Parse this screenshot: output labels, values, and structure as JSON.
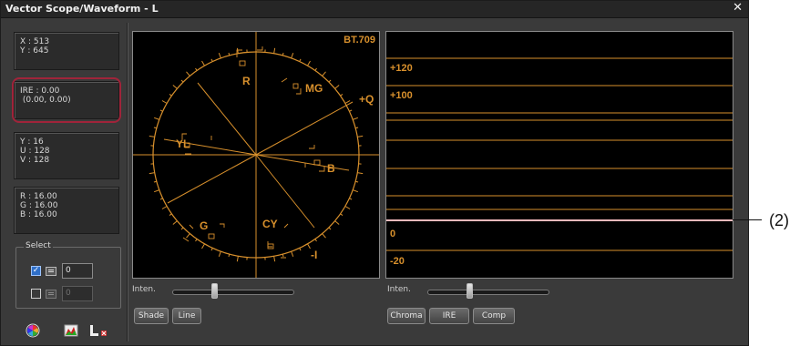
{
  "window": {
    "title": "Vector Scope/Waveform - L",
    "close_glyph": "✕"
  },
  "left_panel": {
    "position": "X : 513\nY : 645",
    "ire": "IRE : 0.00\n (0.00, 0.00)",
    "yuv": "Y : 16\nU : 128\nV : 128",
    "rgb": "R : 16.00\nG : 16.00\nB : 16.00",
    "select": {
      "label": "Select",
      "row1": {
        "checked": true,
        "value": "0"
      },
      "row2": {
        "checked": false,
        "value": "0"
      }
    },
    "icons": [
      "color-wheel-icon",
      "histogram-icon",
      "overlay-l-icon"
    ]
  },
  "vectorscope": {
    "standard": "BT.709",
    "labels": {
      "R": "R",
      "Mg": "MG",
      "Q": "+Q",
      "Yl": "YL",
      "B": "B",
      "G": "G",
      "Cy": "CY",
      "I": "-I"
    },
    "controls": {
      "inten_label": "Inten.",
      "inten_level": 0.35,
      "btn_shade": "Shade",
      "btn_line": "Line"
    }
  },
  "waveform": {
    "labels": {
      "p120": "+120",
      "p100": "+100",
      "zero": "0",
      "m20": "-20"
    },
    "controls": {
      "inten_label": "Inten.",
      "inten_level": 0.35,
      "btn_chroma": "Chroma",
      "btn_ire": "IRE",
      "btn_comp": "Comp"
    }
  },
  "annotation": {
    "text": "(2)"
  },
  "colors": {
    "scope_orange": "#d8902c",
    "highlight_red": "#a0243a",
    "indicator_pink": "#f2b9bb"
  }
}
